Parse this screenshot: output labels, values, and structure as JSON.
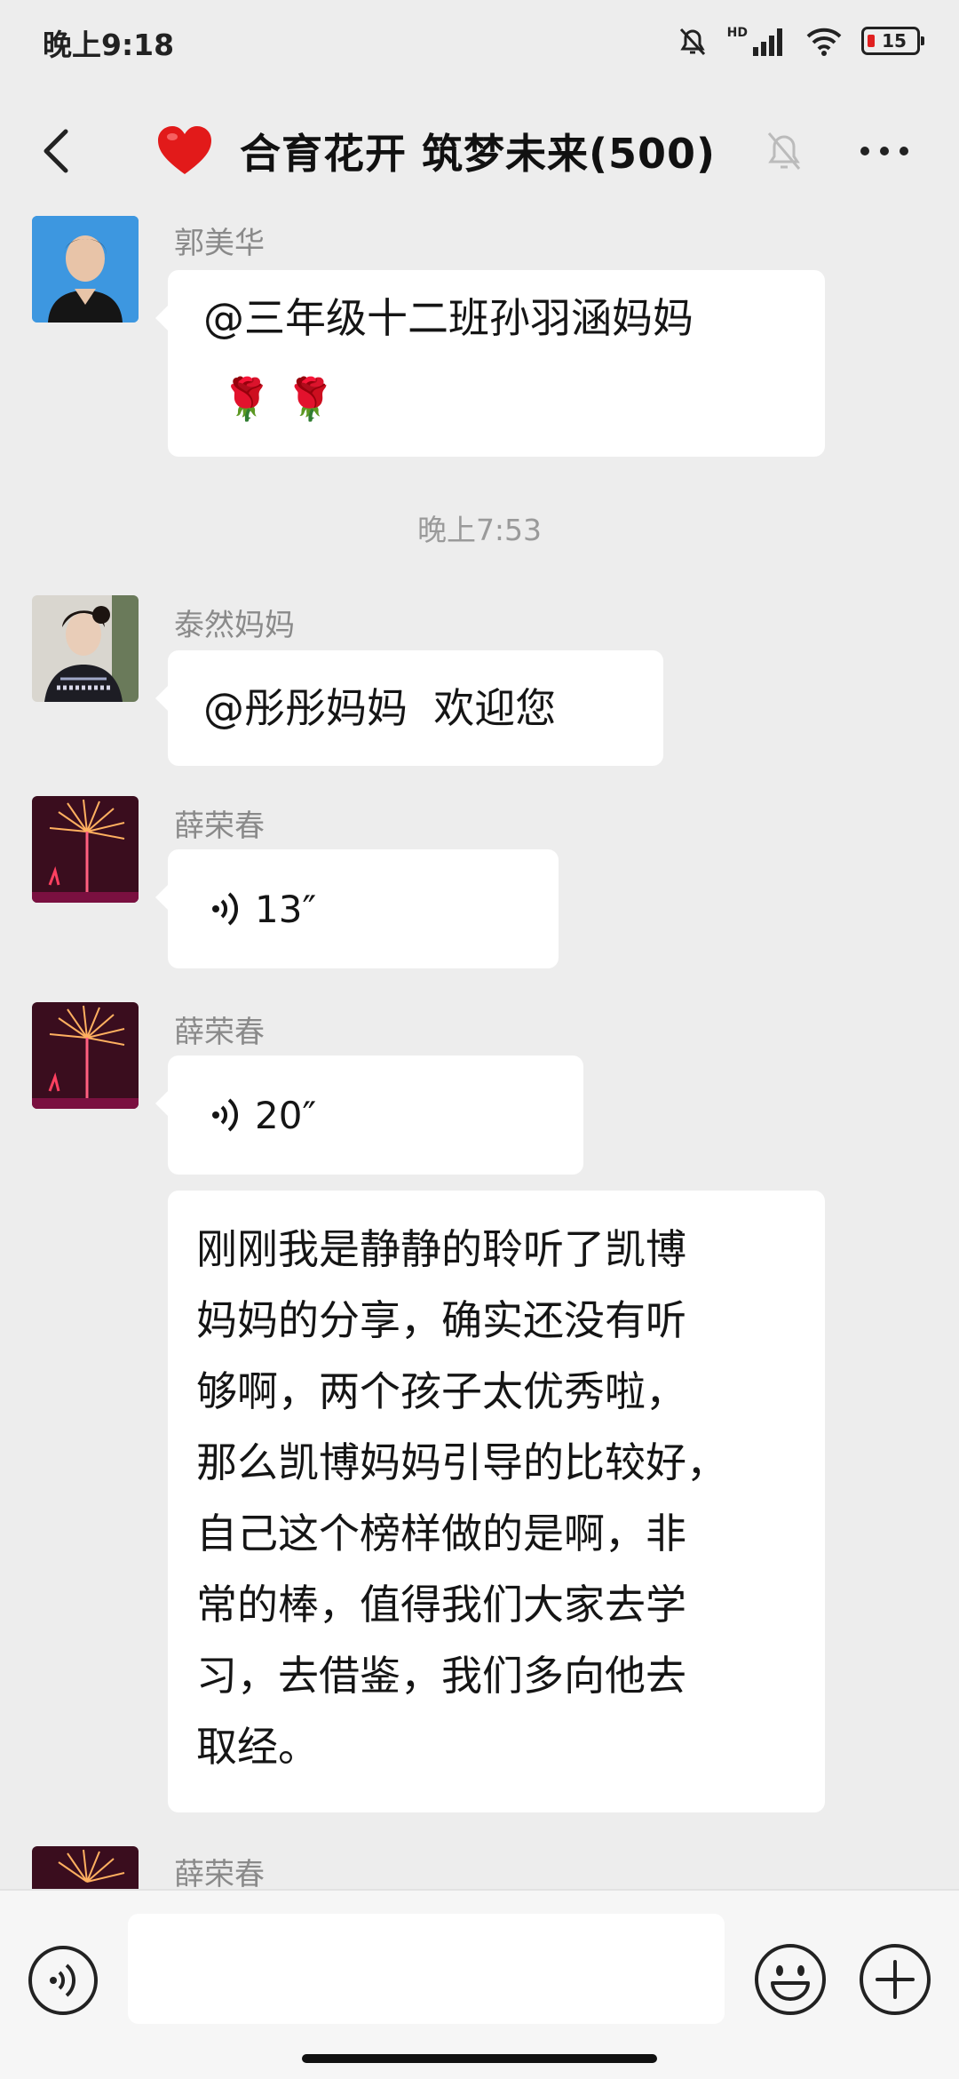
{
  "status_bar": {
    "time": "晚上9:18",
    "network_label": "HD",
    "battery_level": "15"
  },
  "header": {
    "title": "合育花开 筑梦未来(500)"
  },
  "messages": [
    {
      "sender": "郭美华",
      "text_line1": "@三年级十二班孙羽涵妈妈",
      "emoji": "🌹 🌹"
    },
    {
      "timestamp": "晚上7:53"
    },
    {
      "sender": "泰然妈妈",
      "text": "@彤彤妈妈  欢迎您"
    },
    {
      "sender": "薛荣春",
      "voice_duration": "13″"
    },
    {
      "sender": "薛荣春",
      "voice_duration": "20″"
    },
    {
      "lines": [
        "刚刚我是静静的聆听了凯博",
        "妈妈的分享，确实还没有听",
        "够啊，两个孩子太优秀啦，",
        "那么凯博妈妈引导的比较好，",
        "自己这个榜样做的是啊，非",
        "常的棒，值得我们大家去学",
        "习，去借鉴，我们多向他去",
        "取经。"
      ]
    },
    {
      "sender": "薛荣春"
    }
  ],
  "input": {
    "value": "",
    "placeholder": ""
  },
  "icons": {
    "back": "chevron-left-icon",
    "heart": "heart-icon",
    "mute": "bell-off-icon",
    "more": "more-dots-icon",
    "voice": "voice-icon",
    "emoji": "emoji-icon",
    "plus": "plus-icon"
  },
  "colors": {
    "background": "#ededed",
    "bubble": "#ffffff",
    "heart": "#e21a1a",
    "battery_low": "#e02020"
  }
}
